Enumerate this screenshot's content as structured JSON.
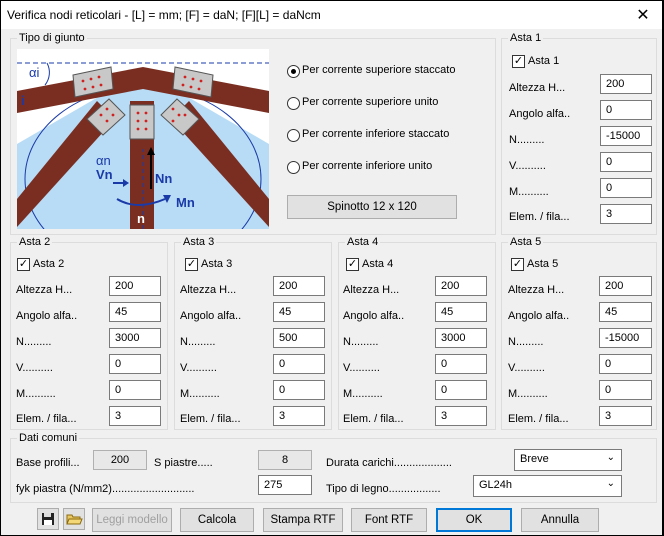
{
  "window": {
    "title": "Verifica nodi reticolari - [L] = mm; [F] = daN; [F][L] = daNcm"
  },
  "joint": {
    "group_label": "Tipo di giunto",
    "options": [
      {
        "label": "Per corrente superiore staccato",
        "selected": true
      },
      {
        "label": "Per corrente superiore unito",
        "selected": false
      },
      {
        "label": "Per corrente inferiore staccato",
        "selected": false
      },
      {
        "label": "Per corrente inferiore unito",
        "selected": false
      }
    ],
    "connector_button": "Spinotto 12 x 120",
    "diagram": {
      "alpha_i": "αi",
      "i": "i",
      "alpha_n": "αn",
      "vn": "Vn",
      "nn": "Nn",
      "mn": "Mn",
      "n": "n"
    }
  },
  "field_labels": {
    "height": "Altezza H...",
    "angle": "Angolo alfa..",
    "n": "N.........",
    "v": "V..........",
    "m": "M..........",
    "elem": "Elem. / fila..."
  },
  "asta": [
    {
      "name": "Asta 1",
      "check": "Asta 1",
      "checked": true,
      "height": "200",
      "angle": "0",
      "n": "-15000",
      "v": "0",
      "m": "0",
      "elem": "3"
    },
    {
      "name": "Asta 2",
      "check": "Asta 2",
      "checked": true,
      "height": "200",
      "angle": "45",
      "n": "3000",
      "v": "0",
      "m": "0",
      "elem": "3"
    },
    {
      "name": "Asta 3",
      "check": "Asta 3",
      "checked": true,
      "height": "200",
      "angle": "45",
      "n": "500",
      "v": "0",
      "m": "0",
      "elem": "3"
    },
    {
      "name": "Asta 4",
      "check": "Asta 4",
      "checked": true,
      "height": "200",
      "angle": "45",
      "n": "3000",
      "v": "0",
      "m": "0",
      "elem": "3"
    },
    {
      "name": "Asta 5",
      "check": "Asta 5",
      "checked": true,
      "height": "200",
      "angle": "45",
      "n": "-15000",
      "v": "0",
      "m": "0",
      "elem": "3"
    }
  ],
  "common": {
    "group_label": "Dati comuni",
    "base_label": "Base profili...",
    "base_value": "200",
    "plates_label": "S piastre.....",
    "plates_value": "8",
    "fyk_label": "fyk piastra (N/mm2)...........................",
    "fyk_value": "275",
    "duration_label": "Durata carichi...................",
    "duration_value": "Breve",
    "wood_label": "Tipo di legno.................",
    "wood_value": "GL24h"
  },
  "buttons": {
    "load_model": "Leggi modello",
    "compute": "Calcola",
    "print_rtf": "Stampa RTF",
    "font_rtf": "Font RTF",
    "ok": "OK",
    "cancel": "Annulla"
  },
  "colors": {
    "wood": "#7a2e22",
    "plate": "#c8c8c8",
    "bg": "#b8dcf6",
    "highlight": "#0078d7"
  }
}
